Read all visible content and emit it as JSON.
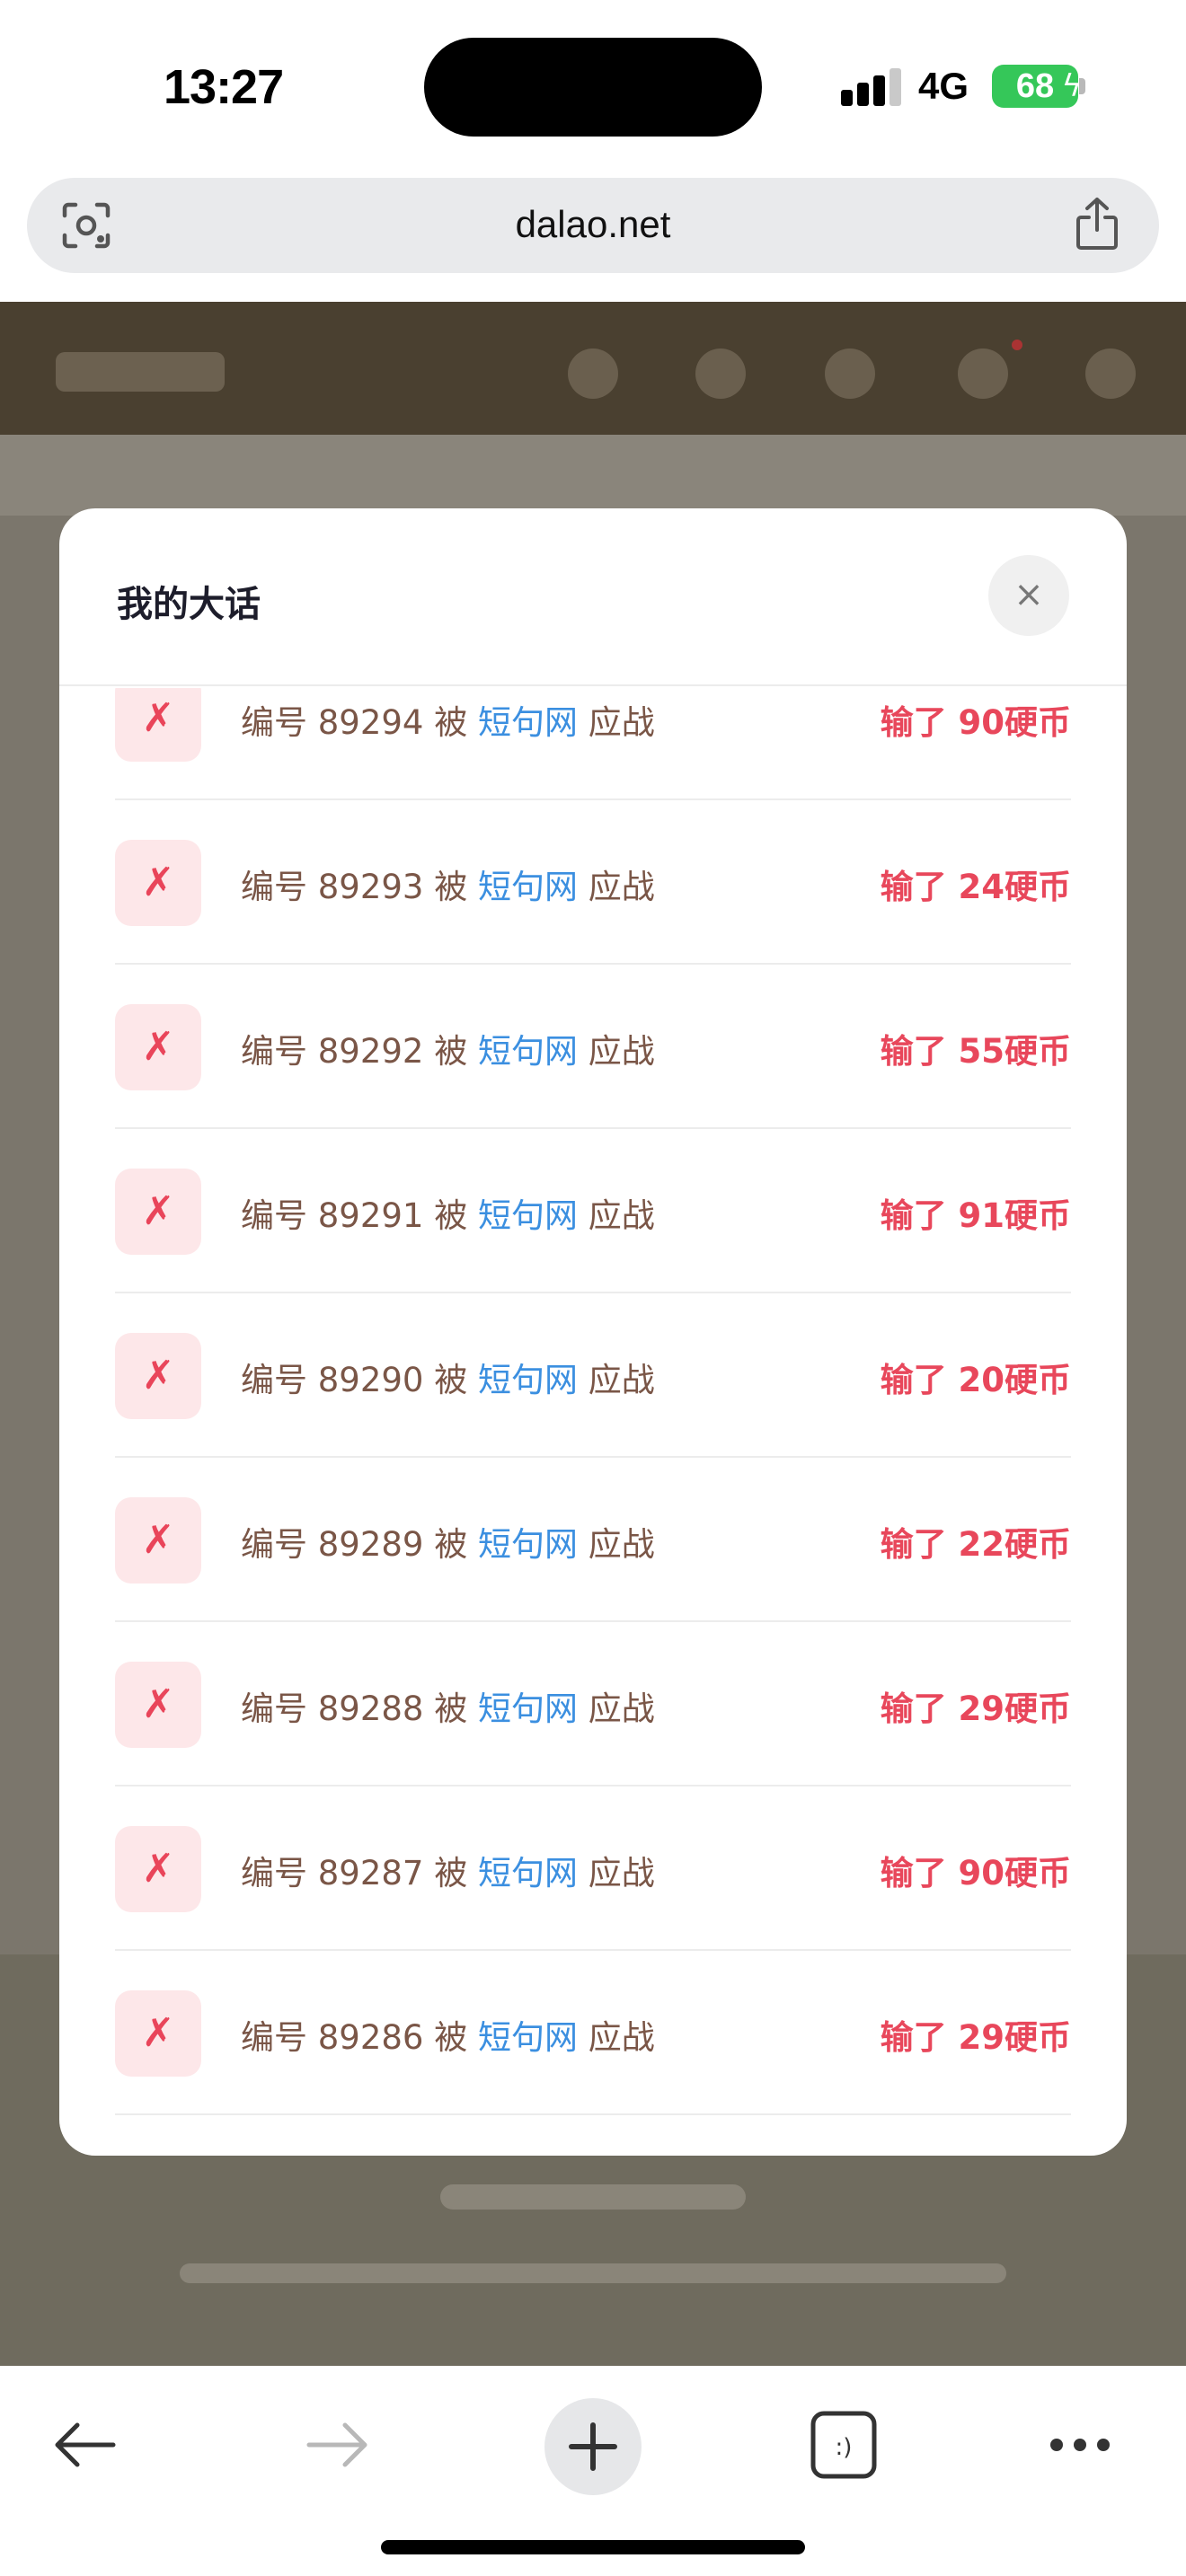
{
  "status_bar": {
    "time": "13:27",
    "network": "4G",
    "battery": "68"
  },
  "browser": {
    "url": "dalao.net",
    "icons": {
      "lens": "camera-lens-icon",
      "share": "share-icon",
      "back": "back-arrow-icon",
      "forward": "forward-arrow-icon",
      "new_tab": "plus-icon",
      "tabs": "tabs-icon",
      "more": "more-dots-icon"
    },
    "tabs_glyph": ":)"
  },
  "modal": {
    "title": "我的大话",
    "close_glyph": "×",
    "items": [
      {
        "badge": "✗",
        "prefix": "编号",
        "id": "89294",
        "by": "被",
        "user": "短句网",
        "action": "应战",
        "result": "输了 90硬币"
      },
      {
        "badge": "✗",
        "prefix": "编号",
        "id": "89293",
        "by": "被",
        "user": "短句网",
        "action": "应战",
        "result": "输了 24硬币"
      },
      {
        "badge": "✗",
        "prefix": "编号",
        "id": "89292",
        "by": "被",
        "user": "短句网",
        "action": "应战",
        "result": "输了 55硬币"
      },
      {
        "badge": "✗",
        "prefix": "编号",
        "id": "89291",
        "by": "被",
        "user": "短句网",
        "action": "应战",
        "result": "输了 91硬币"
      },
      {
        "badge": "✗",
        "prefix": "编号",
        "id": "89290",
        "by": "被",
        "user": "短句网",
        "action": "应战",
        "result": "输了 20硬币"
      },
      {
        "badge": "✗",
        "prefix": "编号",
        "id": "89289",
        "by": "被",
        "user": "短句网",
        "action": "应战",
        "result": "输了 22硬币"
      },
      {
        "badge": "✗",
        "prefix": "编号",
        "id": "89288",
        "by": "被",
        "user": "短句网",
        "action": "应战",
        "result": "输了 29硬币"
      },
      {
        "badge": "✗",
        "prefix": "编号",
        "id": "89287",
        "by": "被",
        "user": "短句网",
        "action": "应战",
        "result": "输了 90硬币"
      },
      {
        "badge": "✗",
        "prefix": "编号",
        "id": "89286",
        "by": "被",
        "user": "短句网",
        "action": "应战",
        "result": "输了 29硬币"
      }
    ]
  },
  "colors": {
    "loss": "#e8475b",
    "user_link": "#3b8fe0",
    "battery": "#35c759"
  }
}
